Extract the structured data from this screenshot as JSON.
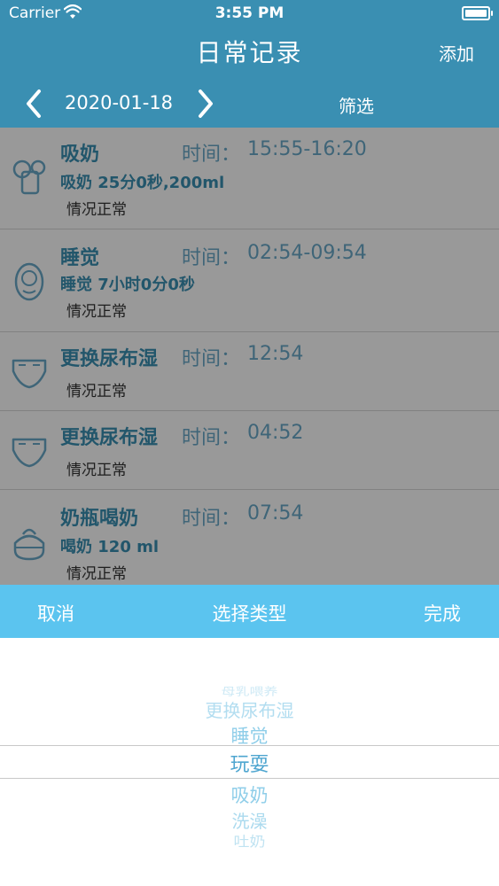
{
  "status_bar": {
    "carrier": "Carrier",
    "time": "3:55 PM"
  },
  "header": {
    "title": "日常记录",
    "add_label": "添加"
  },
  "date_nav": {
    "date": "2020-01-18",
    "filter_label": "筛选"
  },
  "records": [
    {
      "name": "吸奶",
      "time_label": "时间：",
      "time": "15:55-16:20",
      "detail": "吸奶 25分0秒,200ml",
      "status": "情况正常",
      "icon": "breast-pump-icon"
    },
    {
      "name": "睡觉",
      "time_label": "时间：",
      "time": "02:54-09:54",
      "detail": "睡觉 7小时0分0秒",
      "status": "情况正常",
      "icon": "sleeping-baby-icon"
    },
    {
      "name": "更换尿布湿",
      "time_label": "时间：",
      "time": "12:54",
      "detail": "",
      "status": "情况正常",
      "icon": "diaper-icon"
    },
    {
      "name": "更换尿布湿",
      "time_label": "时间：",
      "time": "04:52",
      "detail": "",
      "status": "情况正常",
      "icon": "diaper-icon"
    },
    {
      "name": "奶瓶喝奶",
      "time_label": "时间：",
      "time": "07:54",
      "detail": "喝奶 120 ml",
      "status": "情况正常",
      "icon": "baby-bottle-icon"
    }
  ],
  "picker": {
    "cancel_label": "取消",
    "title": "选择类型",
    "done_label": "完成",
    "options": [
      "母乳喂养",
      "更换尿布湿",
      "睡觉",
      "玩耍",
      "吸奶",
      "洗澡",
      "吐奶"
    ],
    "selected": "玩耍"
  },
  "colors": {
    "header": "#3a8fb2",
    "picker_bar": "#5bc4ef",
    "accent": "#3a8fb2"
  }
}
